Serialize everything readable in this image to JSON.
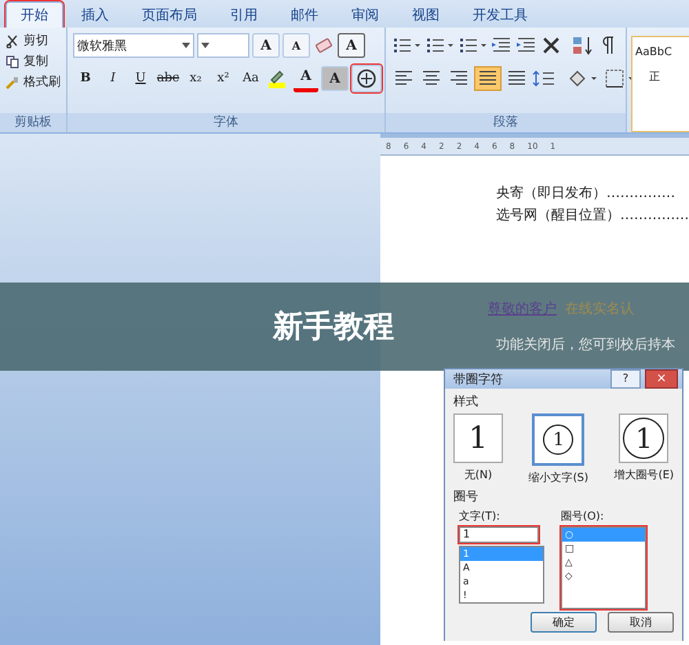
{
  "ribbon": {
    "tabs": [
      {
        "label": "开始",
        "selected": true,
        "marked": true
      },
      {
        "label": "插入",
        "selected": false,
        "marked": false
      },
      {
        "label": "页面布局",
        "selected": false,
        "marked": false
      },
      {
        "label": "引用",
        "selected": false,
        "marked": false
      },
      {
        "label": "邮件",
        "selected": false,
        "marked": false
      },
      {
        "label": "审阅",
        "selected": false,
        "marked": false
      },
      {
        "label": "视图",
        "selected": false,
        "marked": false
      },
      {
        "label": "开发工具",
        "selected": false,
        "marked": false
      }
    ],
    "clipboard": {
      "items": [
        "剪切",
        "复制",
        "格式刷"
      ],
      "label": "剪贴板"
    },
    "font": {
      "name": "微软雅黑",
      "label": "字体",
      "size_buttons": [
        "A",
        "A"
      ],
      "border_button": "A",
      "color_button": "A",
      "shading_button": "A",
      "format_buttons": [
        "B",
        "I",
        "U",
        "abc",
        "x₂",
        "x²",
        "Aa"
      ],
      "enclose_marked": true
    },
    "paragraph": {
      "label": "段落",
      "alignment": [
        {
          "selected": false
        },
        {
          "selected": false
        },
        {
          "selected": false
        },
        {
          "selected": true
        },
        {
          "selected": false
        }
      ]
    },
    "styles": {
      "sample": "AaBbC",
      "name": "正"
    }
  },
  "ruler": [
    "8",
    "6",
    "4",
    "2",
    "2",
    "4",
    "6",
    "8",
    "10",
    "1"
  ],
  "document": {
    "lines": [
      "央寄（即日发布）……………",
      "选号网（醒目位置）……………"
    ],
    "link": "尊敬的客户",
    "after_link": "在线实名认",
    "note": "功能关闭后，您可到校后持本"
  },
  "banner": "新手教程",
  "dialog": {
    "title": "带圈字符",
    "help": "?",
    "close": "×",
    "style_label": "样式",
    "styles": [
      {
        "label": "无(N)",
        "selected": false,
        "kind": "none",
        "preview": "1"
      },
      {
        "label": "缩小文字(S)",
        "selected": true,
        "kind": "shrink",
        "preview": "1"
      },
      {
        "label": "增大圈号(E)",
        "selected": false,
        "kind": "enlarge",
        "preview": "1"
      }
    ],
    "enclosure_label": "圈号",
    "text_label": "文字(T):",
    "text_value": "1",
    "text_marked": true,
    "text_options": [
      {
        "label": "1",
        "selected": true
      },
      {
        "label": "A",
        "selected": false
      },
      {
        "label": "a",
        "selected": false
      },
      {
        "label": "!",
        "selected": false
      }
    ],
    "shape_label": "圈号(O):",
    "shape_marked": true,
    "shapes": [
      {
        "label": "○",
        "selected": true
      },
      {
        "label": "□",
        "selected": false
      },
      {
        "label": "△",
        "selected": false
      },
      {
        "label": "◇",
        "selected": false
      }
    ],
    "buttons": [
      "确定",
      "取消"
    ]
  }
}
